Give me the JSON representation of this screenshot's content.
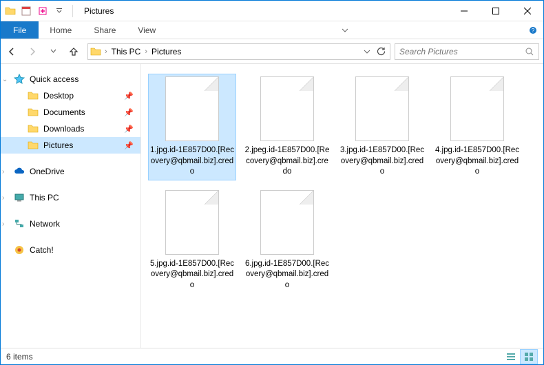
{
  "title": "Pictures",
  "ribbon": {
    "file": "File",
    "tabs": [
      "Home",
      "Share",
      "View"
    ]
  },
  "breadcrumb": {
    "items": [
      "This PC",
      "Pictures"
    ]
  },
  "search": {
    "placeholder": "Search Pictures"
  },
  "nav": {
    "quick_access": "Quick access",
    "quick_items": [
      {
        "label": "Desktop",
        "pinned": true
      },
      {
        "label": "Documents",
        "pinned": true
      },
      {
        "label": "Downloads",
        "pinned": true
      },
      {
        "label": "Pictures",
        "pinned": true,
        "selected": true
      }
    ],
    "onedrive": "OneDrive",
    "this_pc": "This PC",
    "network": "Network",
    "catch": "Catch!"
  },
  "files": [
    {
      "name": "1.jpg.id-1E857D00.[Recovery@qbmail.biz].credo",
      "selected": true
    },
    {
      "name": "2.jpeg.id-1E857D00.[Recovery@qbmail.biz].credo"
    },
    {
      "name": "3.jpg.id-1E857D00.[Recovery@qbmail.biz].credo"
    },
    {
      "name": "4.jpg.id-1E857D00.[Recovery@qbmail.biz].credo"
    },
    {
      "name": "5.jpg.id-1E857D00.[Recovery@qbmail.biz].credo"
    },
    {
      "name": "6.jpg.id-1E857D00.[Recovery@qbmail.biz].credo"
    }
  ],
  "status": {
    "count_text": "6 items"
  }
}
